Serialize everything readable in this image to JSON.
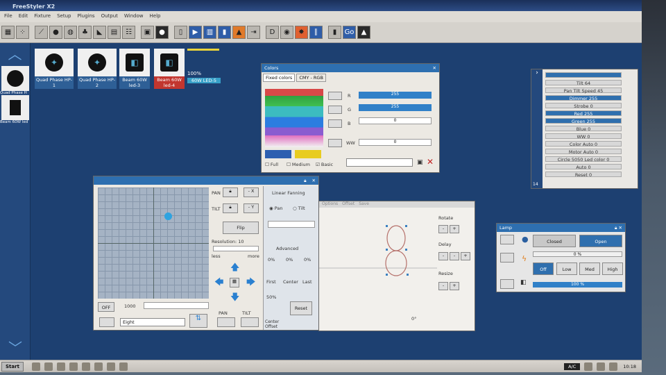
{
  "app": {
    "title": "FreeStyler X2"
  },
  "menu": [
    "File",
    "Edit",
    "Fixture",
    "Setup",
    "Plugins",
    "Output",
    "Window",
    "Help"
  ],
  "fixtures": [
    {
      "name": "Quad Phase HP-1"
    },
    {
      "name": "Quad Phase HP-2"
    },
    {
      "name": "Beam 60W led-3"
    },
    {
      "name": "Beam 60W led-4"
    }
  ],
  "sidepanel": [
    "Quad Phase H",
    "Beam 60W led"
  ],
  "progress": {
    "label": "100%",
    "value": 1.0,
    "fixture": "60W LED-5"
  },
  "colors": {
    "title": "Colors",
    "tabs": [
      "Fixed colors",
      "CMY - RGB"
    ],
    "r_label": "R",
    "g_label": "G",
    "b_label": "B",
    "ww_label": "WW",
    "r": "255",
    "g": "255",
    "b": "0",
    "ww": "0",
    "checks": [
      "Full",
      "Medium",
      "Basic"
    ]
  },
  "pantilt": {
    "pan_label": "PAN",
    "tilt_label": "TILT",
    "x_btn": "- X",
    "y_btn": "- Y",
    "flip": "Flip",
    "resolution": "Resolution: 10",
    "less": "less",
    "more": "more",
    "off": "OFF",
    "value": "1000",
    "eight": "Eight",
    "pan_bottom": "PAN",
    "tilt_bottom": "TILT"
  },
  "fanning": {
    "title": "Linear Fanning",
    "pan": "Pan",
    "tilt": "Tilt",
    "advanced": "Advanced",
    "pcts": [
      "0%",
      "0%",
      "0%"
    ],
    "cols": [
      "First",
      "Center",
      "Last"
    ],
    "pct50": "50%",
    "center_offset": "Center Offset",
    "reset": "Reset"
  },
  "shape": {
    "tabs": [
      "Options",
      "Offset",
      "Save"
    ],
    "rotate": "Rotate",
    "delay": "Delay",
    "resize": "Resize",
    "degree": "0°"
  },
  "lamp": {
    "title": "Lamp",
    "closed": "Closed",
    "open": "Open",
    "off": "Off",
    "low": "Low",
    "med": "Med",
    "high": "High",
    "pct1": "0 %",
    "pct2": "100 %"
  },
  "channels": {
    "num": "14",
    "rows": [
      "",
      "Tilt 64",
      "Pan Tilt Speed 45",
      "Dimmer 255",
      "Strobe 0",
      "Red 255",
      "Green 255",
      "Blue 0",
      "WW 0",
      "Color Auto 0",
      "Motor Auto 0",
      "Circle 5050 Led color 0",
      "Auto 0",
      "Reset 0"
    ]
  },
  "taskbar": {
    "start": "Start",
    "kb": "A/C",
    "clock": "10:18"
  }
}
